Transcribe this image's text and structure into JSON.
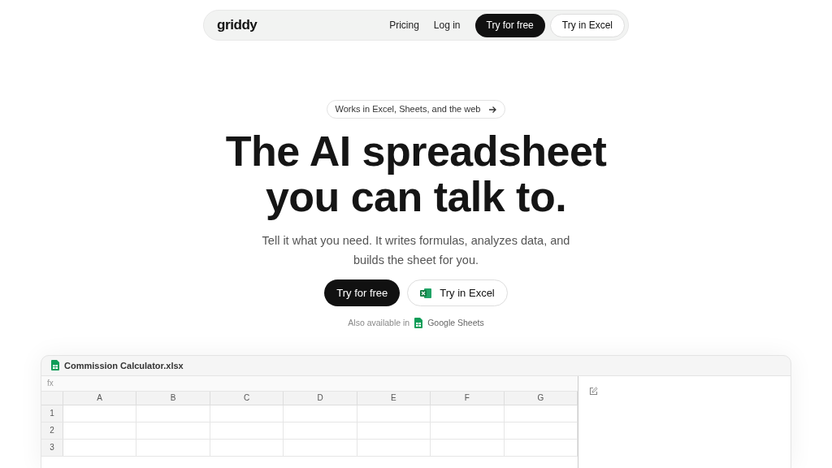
{
  "nav": {
    "logo": "griddy",
    "links": [
      "Pricing",
      "Log in"
    ],
    "primary_button": "Try for free",
    "secondary_button": "Try in Excel"
  },
  "hero": {
    "badge": "Works in Excel, Sheets, and the web",
    "title_lines": [
      "The AI spreadsheet",
      "you can talk to."
    ],
    "subtitle_lines": [
      "Tell it what you need. It writes formulas, analyzes data, and",
      "builds the sheet for you."
    ],
    "primary_button": "Try for free",
    "secondary_button": "Try in Excel",
    "also_available": "Also available in",
    "also_link": "Google Sheets"
  },
  "sheet": {
    "file_name": "Commission Calculator.xlsx",
    "formula_label": "fx",
    "columns": [
      "A",
      "B",
      "C",
      "D",
      "E",
      "F",
      "G"
    ],
    "rows": [
      "1",
      "2",
      "3"
    ]
  }
}
